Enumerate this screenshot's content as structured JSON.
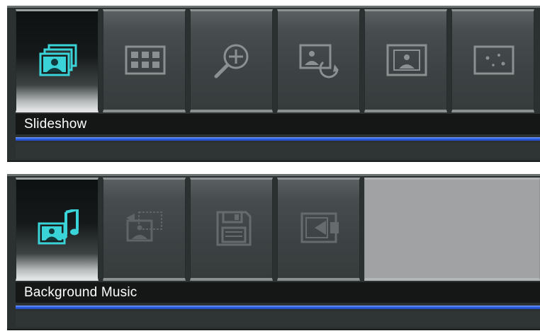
{
  "panels": [
    {
      "label": "Slideshow",
      "tiles": [
        {
          "icon": "slideshow-icon",
          "selected": true
        },
        {
          "icon": "thumbnail-grid-icon",
          "selected": false
        },
        {
          "icon": "zoom-in-icon",
          "selected": false
        },
        {
          "icon": "rotate-photo-icon",
          "selected": false
        },
        {
          "icon": "fit-to-screen-icon",
          "selected": false
        },
        {
          "icon": "slideshow-effects-icon",
          "selected": false
        }
      ]
    },
    {
      "label": "Background Music",
      "tiles": [
        {
          "icon": "background-music-icon",
          "selected": true
        },
        {
          "icon": "copy-photos-icon",
          "selected": false
        },
        {
          "icon": "save-icon",
          "selected": false
        },
        {
          "icon": "exit-icon",
          "selected": false
        }
      ]
    }
  ],
  "colors": {
    "accent_line": "#2f62e6",
    "active_icon": "#39d3d8",
    "inactive_icon": "#8b9192",
    "label_text": "#ffffff"
  }
}
